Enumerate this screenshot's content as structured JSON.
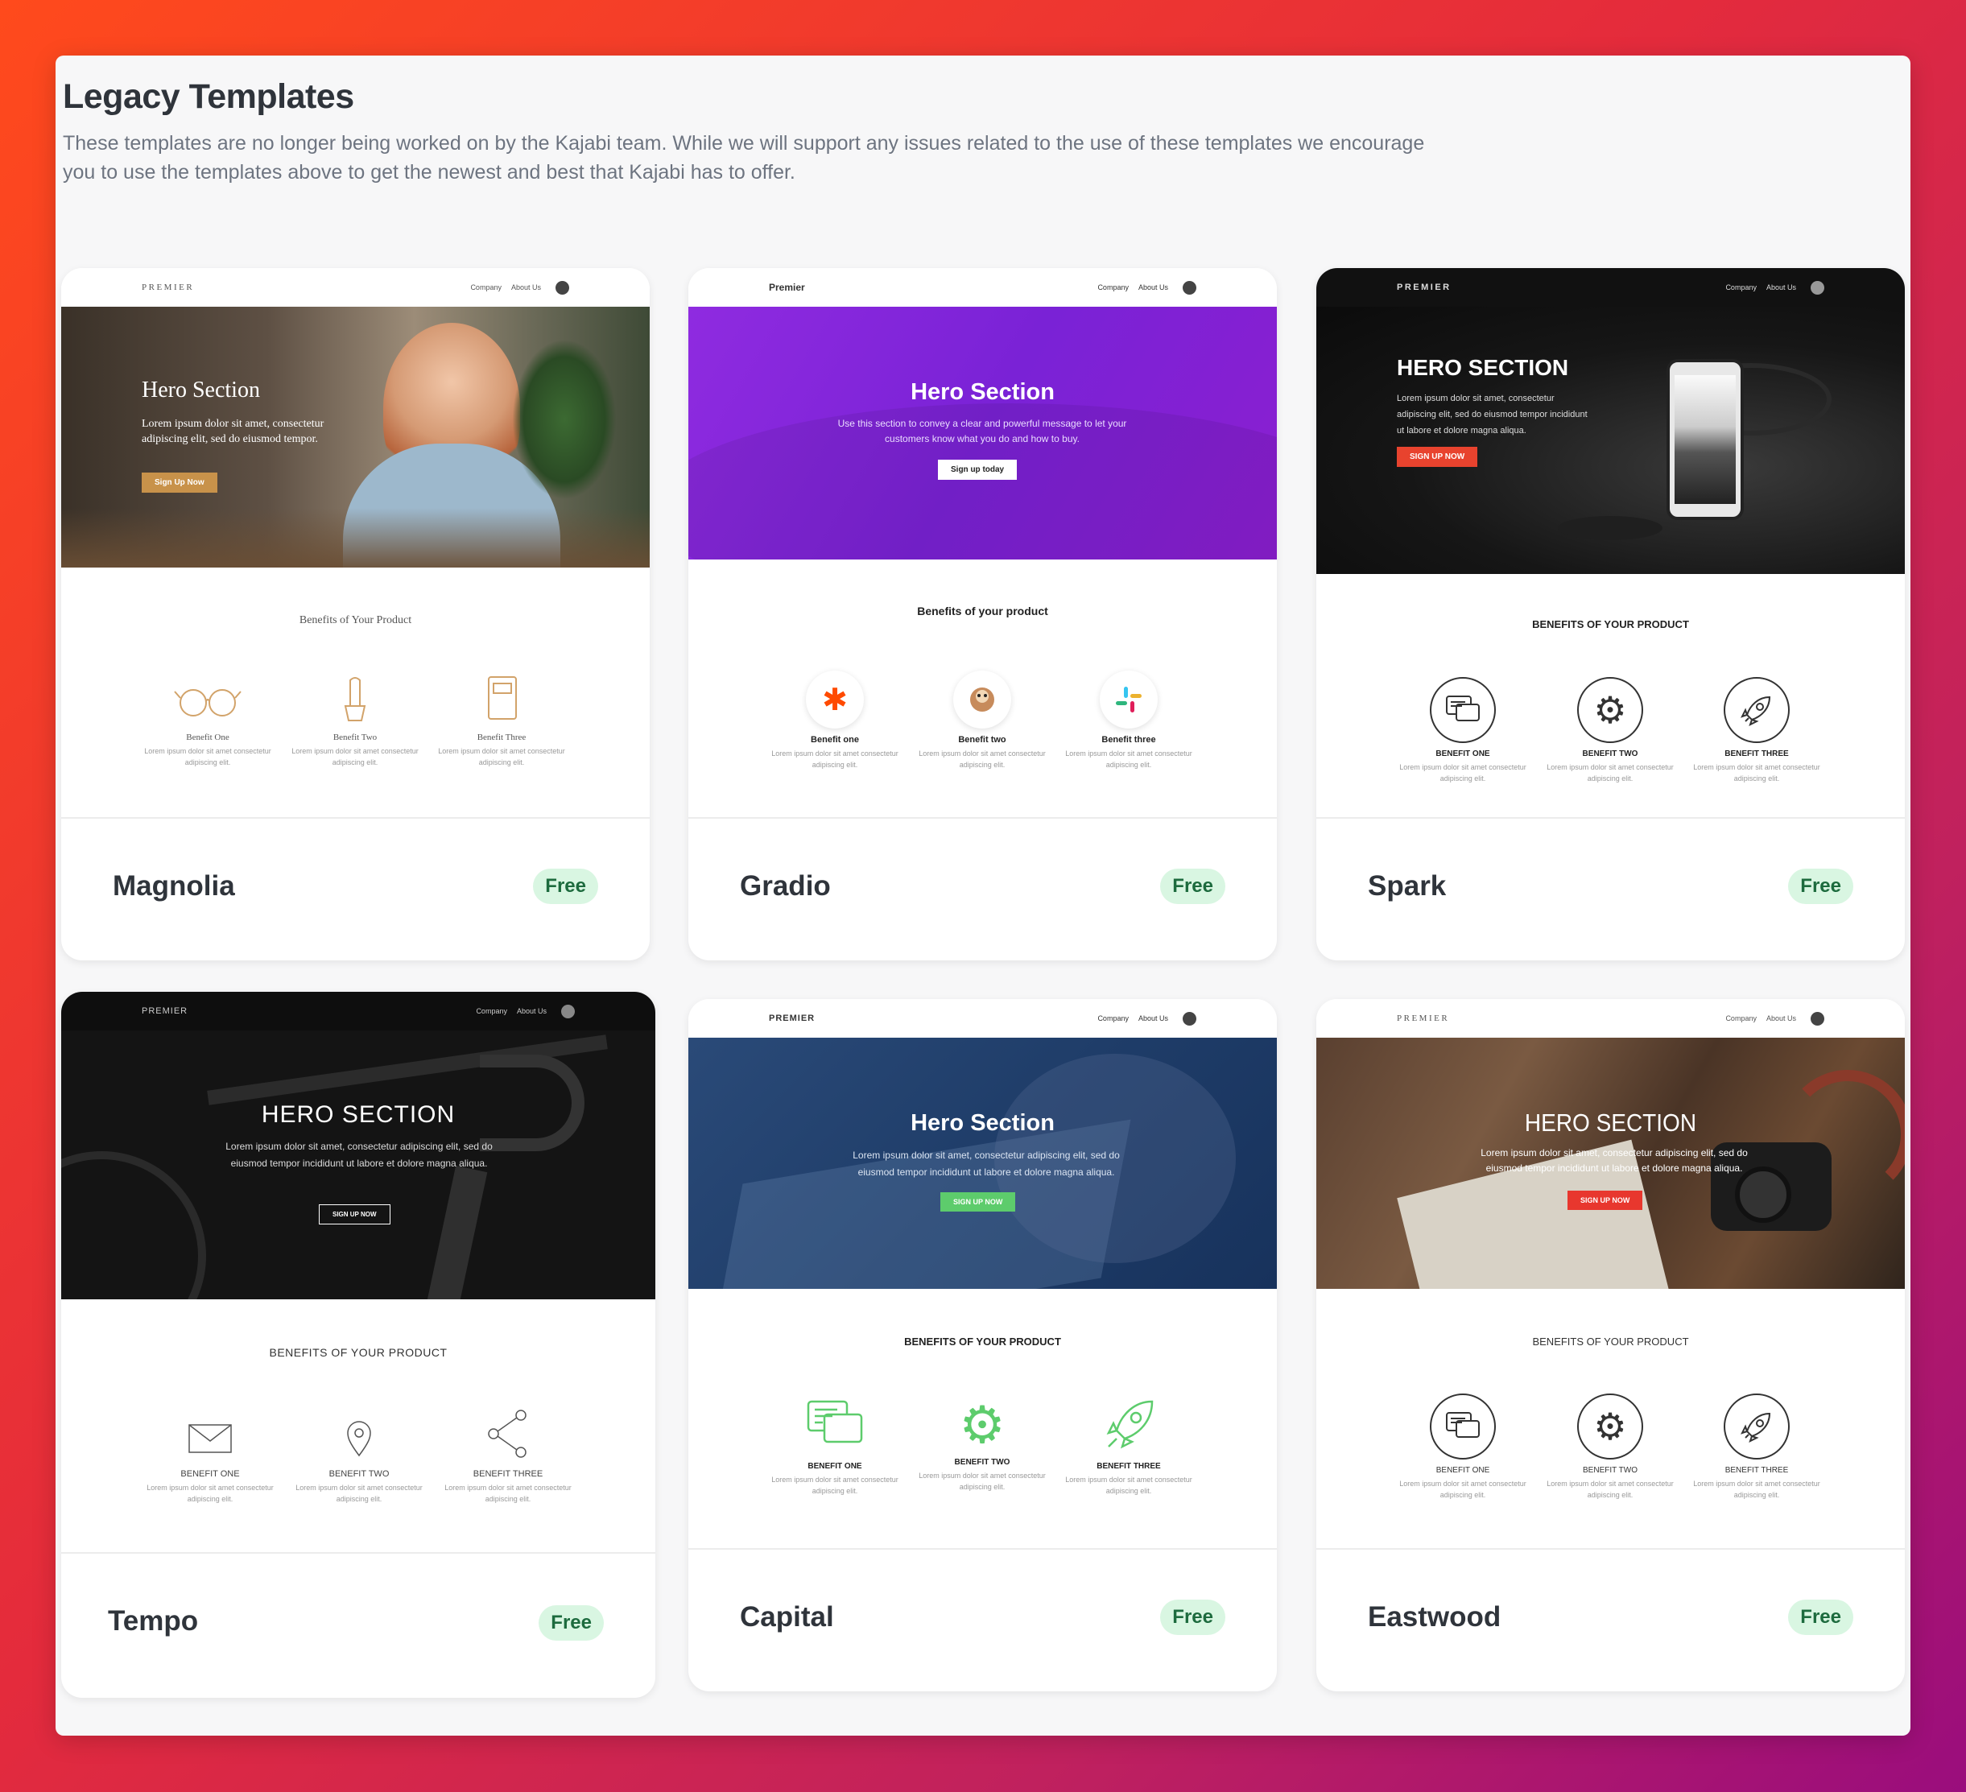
{
  "page": {
    "title": "Legacy Templates",
    "description": "These templates are no longer being worked on by the Kajabi team. While we will support any issues related to the use of these templates we encourage you to use the templates above to get the newest and best that Kajabi has to offer."
  },
  "badge_color": "#d9f6e2",
  "cards": [
    {
      "name": "Magnolia",
      "badge": "Free",
      "preview": {
        "logo": "PREMIER",
        "nav_company": "Company",
        "nav_about": "About Us",
        "hero_title": "Hero Section",
        "hero_text": "Lorem ipsum dolor sit amet, consectetur adipiscing elit, sed do eiusmod tempor.",
        "hero_button": "Sign Up Now",
        "benefits_title": "Benefits of Your Product",
        "benefits": [
          {
            "name": "Benefit One",
            "text": "Lorem ipsum dolor sit amet consectetur adipiscing elit.",
            "icon": "glasses-icon"
          },
          {
            "name": "Benefit Two",
            "text": "Lorem ipsum dolor sit amet consectetur adipiscing elit.",
            "icon": "cactus-icon"
          },
          {
            "name": "Benefit Three",
            "text": "Lorem ipsum dolor sit amet consectetur adipiscing elit.",
            "icon": "notebook-icon"
          }
        ]
      }
    },
    {
      "name": "Gradio",
      "badge": "Free",
      "preview": {
        "logo": "Premier",
        "nav_company": "Company",
        "nav_about": "About Us",
        "hero_title": "Hero Section",
        "hero_text": "Use this section to convey a clear and powerful message to let your customers know what you do and how to buy.",
        "hero_button": "Sign up today",
        "benefits_title": "Benefits of your product",
        "benefits": [
          {
            "name": "Benefit one",
            "text": "Lorem ipsum dolor sit amet consectetur adipiscing elit.",
            "icon": "zapier-icon"
          },
          {
            "name": "Benefit two",
            "text": "Lorem ipsum dolor sit amet consectetur adipiscing elit.",
            "icon": "mailchimp-icon"
          },
          {
            "name": "Benefit three",
            "text": "Lorem ipsum dolor sit amet consectetur adipiscing elit.",
            "icon": "slack-icon"
          }
        ]
      }
    },
    {
      "name": "Spark",
      "badge": "Free",
      "preview": {
        "logo": "PREMIER",
        "nav_company": "Company",
        "nav_about": "About Us",
        "hero_title": "HERO SECTION",
        "hero_text": "Lorem ipsum dolor sit amet, consectetur adipiscing elit, sed do eiusmod tempor incididunt ut labore et dolore magna aliqua.",
        "hero_button": "SIGN UP NOW",
        "benefits_title": "BENEFITS OF YOUR PRODUCT",
        "benefits": [
          {
            "name": "BENEFIT ONE",
            "text": "Lorem ipsum dolor sit amet consectetur adipiscing elit.",
            "icon": "chat-icon"
          },
          {
            "name": "BENEFIT TWO",
            "text": "Lorem ipsum dolor sit amet consectetur adipiscing elit.",
            "icon": "gear-icon"
          },
          {
            "name": "BENEFIT THREE",
            "text": "Lorem ipsum dolor sit amet consectetur adipiscing elit.",
            "icon": "rocket-icon"
          }
        ]
      }
    },
    {
      "name": "Tempo",
      "badge": "Free",
      "preview": {
        "logo": "PREMIER",
        "nav_company": "Company",
        "nav_about": "About Us",
        "hero_title": "HERO SECTION",
        "hero_text": "Lorem ipsum dolor sit amet, consectetur adipiscing elit, sed do eiusmod tempor incididunt ut labore et dolore magna aliqua.",
        "hero_button": "SIGN UP NOW",
        "benefits_title": "BENEFITS OF YOUR PRODUCT",
        "benefits": [
          {
            "name": "BENEFIT ONE",
            "text": "Lorem ipsum dolor sit amet consectetur adipiscing elit.",
            "icon": "envelope-icon"
          },
          {
            "name": "BENEFIT TWO",
            "text": "Lorem ipsum dolor sit amet consectetur adipiscing elit.",
            "icon": "map-pin-icon"
          },
          {
            "name": "BENEFIT THREE",
            "text": "Lorem ipsum dolor sit amet consectetur adipiscing elit.",
            "icon": "share-icon"
          }
        ]
      }
    },
    {
      "name": "Capital",
      "badge": "Free",
      "preview": {
        "logo": "PREMIER",
        "nav_company": "Company",
        "nav_about": "About Us",
        "hero_title": "Hero Section",
        "hero_text": "Lorem ipsum dolor sit amet, consectetur adipiscing elit, sed do eiusmod tempor incididunt ut labore et dolore magna aliqua.",
        "hero_button": "SIGN UP NOW",
        "benefits_title": "BENEFITS OF YOUR PRODUCT",
        "benefits": [
          {
            "name": "BENEFIT ONE",
            "text": "Lorem ipsum dolor sit amet consectetur adipiscing elit.",
            "icon": "chat-icon"
          },
          {
            "name": "BENEFIT TWO",
            "text": "Lorem ipsum dolor sit amet consectetur adipiscing elit.",
            "icon": "gear-icon"
          },
          {
            "name": "BENEFIT THREE",
            "text": "Lorem ipsum dolor sit amet consectetur adipiscing elit.",
            "icon": "rocket-icon"
          }
        ]
      }
    },
    {
      "name": "Eastwood",
      "badge": "Free",
      "preview": {
        "logo": "PREMIER",
        "nav_company": "Company",
        "nav_about": "About Us",
        "hero_title": "HERO SECTION",
        "hero_text": "Lorem ipsum dolor sit amet, consectetur adipiscing elit, sed do eiusmod tempor incididunt ut labore et dolore magna aliqua.",
        "hero_button": "SIGN UP NOW",
        "benefits_title": "BENEFITS OF YOUR PRODUCT",
        "benefits": [
          {
            "name": "BENEFIT ONE",
            "text": "Lorem ipsum dolor sit amet consectetur adipiscing elit.",
            "icon": "chat-icon"
          },
          {
            "name": "BENEFIT TWO",
            "text": "Lorem ipsum dolor sit amet consectetur adipiscing elit.",
            "icon": "gear-icon"
          },
          {
            "name": "BENEFIT THREE",
            "text": "Lorem ipsum dolor sit amet consectetur adipiscing elit.",
            "icon": "rocket-icon"
          }
        ]
      }
    }
  ]
}
